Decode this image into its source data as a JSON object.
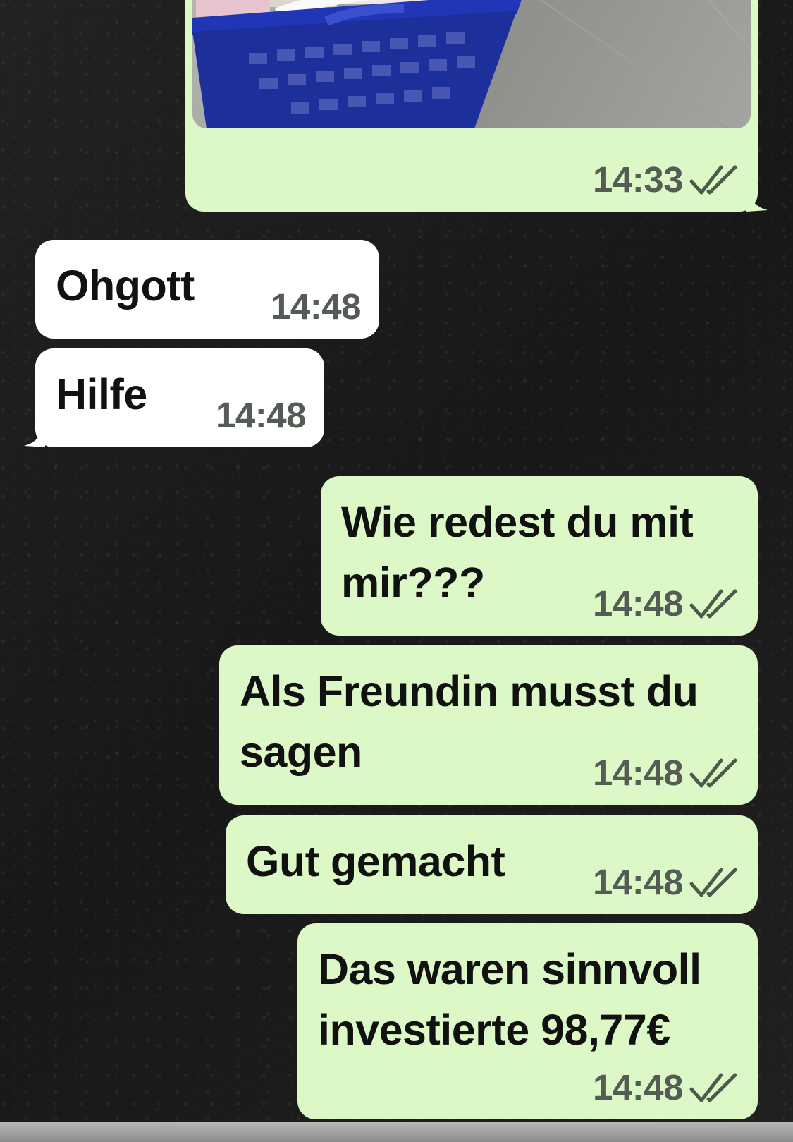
{
  "messages": [
    {
      "direction": "out",
      "kind": "photo",
      "time": "14:33",
      "status": "read"
    },
    {
      "direction": "in",
      "text": "Ohgott",
      "time": "14:48"
    },
    {
      "direction": "in",
      "text": "Hilfe",
      "time": "14:48"
    },
    {
      "direction": "out",
      "text": "Wie redest du mit mir???",
      "time": "14:48",
      "status": "read"
    },
    {
      "direction": "out",
      "text": "Als Freundin musst du sagen",
      "time": "14:48",
      "status": "read"
    },
    {
      "direction": "out",
      "text": "Gut gemacht",
      "time": "14:48",
      "status": "read"
    },
    {
      "direction": "out",
      "text": "Das waren sinnvoll investierte 98,77€",
      "time": "14:48",
      "status": "read"
    }
  ],
  "colors": {
    "outgoing_bubble": "#dcf8c6",
    "incoming_bubble": "#ffffff",
    "timestamp": "#555b55",
    "background": "#1d1d1d",
    "basket": "#1f35b8"
  },
  "icons": {
    "read_receipt": "double-check-icon"
  }
}
